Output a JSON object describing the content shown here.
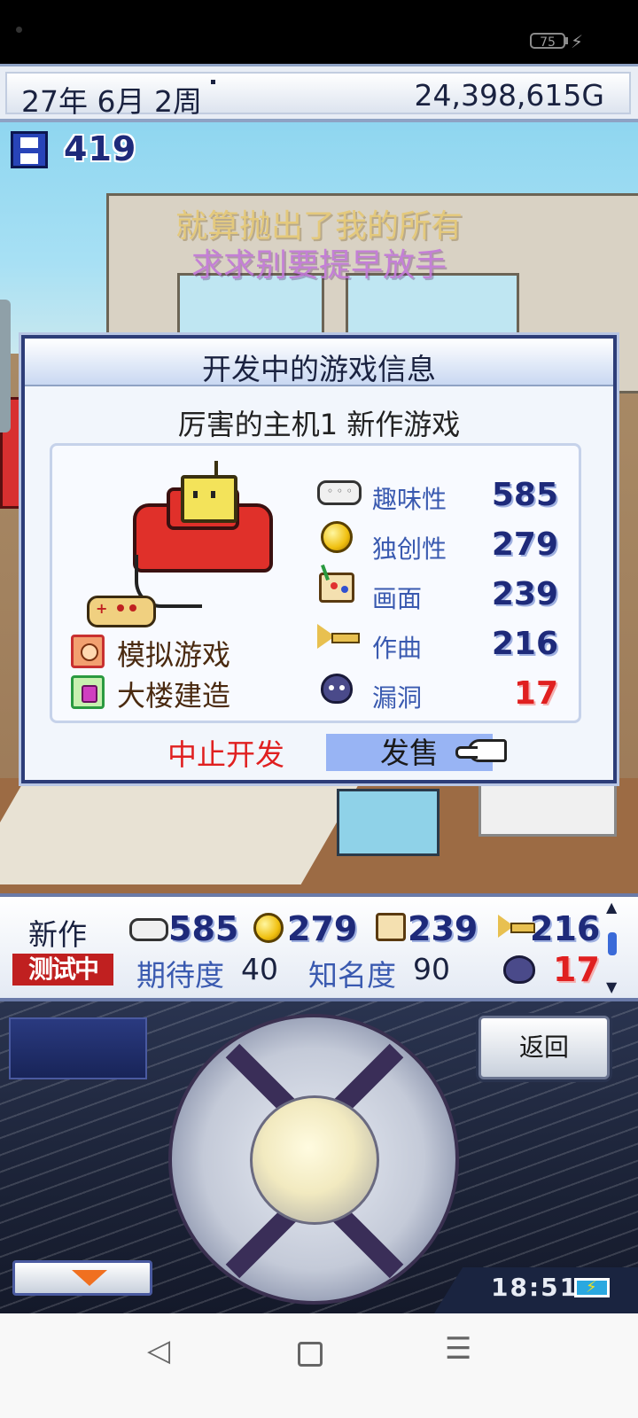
{
  "status_bar": {
    "battery": "75"
  },
  "header": {
    "date": "27年 6月 2周",
    "gold": "24,398,615G"
  },
  "save_points": "419",
  "lyrics": {
    "line1": "就算抛出了我的所有",
    "line2": "求求别要提早放手"
  },
  "dialog": {
    "title": "开发中的游戏信息",
    "game_name": "厉害的主机1 新作游戏",
    "genres": [
      "模拟游戏",
      "大楼建造"
    ],
    "stats": [
      {
        "icon": "gamepad-icon",
        "label": "趣味性",
        "value": "585"
      },
      {
        "icon": "coin-icon",
        "label": "独创性",
        "value": "279"
      },
      {
        "icon": "paint-palette-icon",
        "label": "画面",
        "value": "239"
      },
      {
        "icon": "horn-icon",
        "label": "作曲",
        "value": "216"
      },
      {
        "icon": "bug-icon",
        "label": "漏洞",
        "value": "17"
      }
    ],
    "stop_label": "中止开发",
    "release_label": "发售"
  },
  "info_bar": {
    "title": "新作",
    "status": "测试中",
    "fun": "585",
    "originality": "279",
    "graphics": "239",
    "sound": "216",
    "bugs": "17",
    "expectation_label": "期待度",
    "expectation_value": "40",
    "fame_label": "知名度",
    "fame_value": "90"
  },
  "controls": {
    "back_label": "返回",
    "clock": "18:51"
  },
  "colors": {
    "accent_blue": "#98b4f4",
    "stop_red": "#e02020",
    "stat_blue": "#1e2a7a"
  }
}
